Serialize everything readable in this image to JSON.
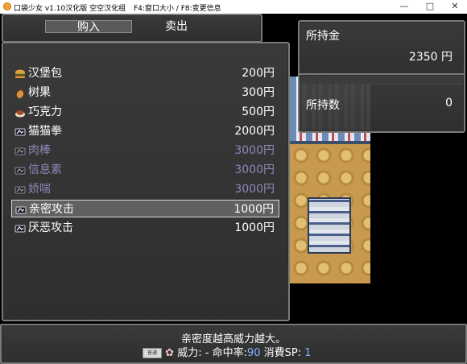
{
  "window": {
    "title": "口袋少女 v1.10汉化版 空空汉化组",
    "hint": "F4:窗口大小 / F8:变更信息"
  },
  "tabs": {
    "buy": "购入",
    "sell": "卖出"
  },
  "items": [
    {
      "name": "汉堡包",
      "price": "200円",
      "icon": "burger-icon",
      "enabled": true
    },
    {
      "name": "树果",
      "price": "300円",
      "icon": "berry-icon",
      "enabled": true
    },
    {
      "name": "巧克力",
      "price": "500円",
      "icon": "chocolate-icon",
      "enabled": true
    },
    {
      "name": "猫猫拳",
      "price": "2000円",
      "icon": "skill-card-icon",
      "enabled": true
    },
    {
      "name": "肉棒",
      "price": "3000円",
      "icon": "skill-card-icon",
      "enabled": false
    },
    {
      "name": "信息素",
      "price": "3000円",
      "icon": "skill-card-icon",
      "enabled": false
    },
    {
      "name": "娇喘",
      "price": "3000円",
      "icon": "skill-card-icon",
      "enabled": false
    },
    {
      "name": "亲密攻击",
      "price": "1000円",
      "icon": "skill-card-icon",
      "enabled": true,
      "selected": true
    },
    {
      "name": "厌恶攻击",
      "price": "1000円",
      "icon": "skill-card-icon",
      "enabled": true
    }
  ],
  "gold": {
    "label": "所持金",
    "value": "2350",
    "unit": "円"
  },
  "owned": {
    "label": "所持数",
    "value": "0"
  },
  "help": {
    "line1": "亲密度越高威力越大。",
    "badge": "普通",
    "power_label": "威力:",
    "power_value": "-",
    "accuracy_label": "命中率:",
    "accuracy_value": "90",
    "sp_label": "消費SP:",
    "sp_value": "1"
  },
  "colors": {
    "disabled_text": "#8d87b8",
    "highlight_value": "#7fb3ff"
  }
}
